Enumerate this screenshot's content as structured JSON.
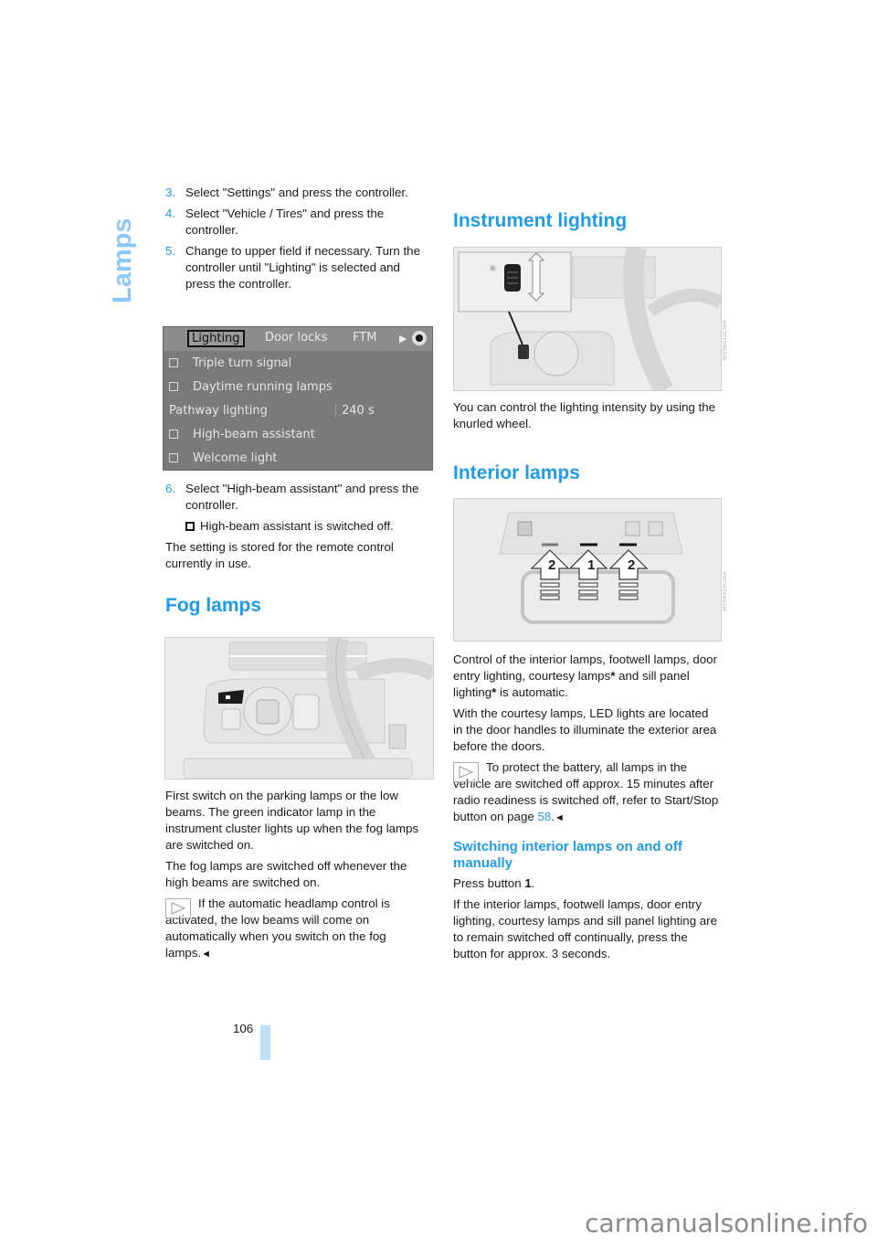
{
  "section_title": "Lamps",
  "page_number": "106",
  "left_column": {
    "steps_a": [
      {
        "num": "3.",
        "text": "Select \"Settings\" and press the controller."
      },
      {
        "num": "4.",
        "text": "Select \"Vehicle / Tires\" and press the controller."
      },
      {
        "num": "5.",
        "text": "Change to upper field if necessary. Turn the controller until \"Lighting\" is selected and press the controller."
      }
    ],
    "screen": {
      "tabs": [
        "Lighting",
        "Door locks",
        "FTM"
      ],
      "selected_tab": "Lighting",
      "rows": [
        {
          "label": "Triple turn signal",
          "checked": false
        },
        {
          "label": "Daytime running lamps",
          "checked": false
        },
        {
          "label": "Pathway lighting",
          "value": "240 s"
        },
        {
          "label": "High-beam assistant",
          "checked": false
        },
        {
          "label": "Welcome light",
          "checked": false
        }
      ]
    },
    "step_6": {
      "num": "6.",
      "text": "Select \"High-beam assistant\" and press the controller."
    },
    "checkbox_note": "High-beam assistant is switched off.",
    "stored_text": "The setting is stored for the remote control currently in use.",
    "fog_heading": "Fog lamps",
    "fog_p1": "First switch on the parking lamps or the low beams. The green indicator lamp in the instrument cluster lights up when the fog lamps are switched on.",
    "fog_p2": "The fog lamps are switched off whenever the high beams are switched on.",
    "fog_note": "If the automatic headlamp control is activated, the low beams will come on automatically when you switch on the fog lamps.",
    "end_mark": "◄"
  },
  "right_column": {
    "instrument_heading": "Instrument lighting",
    "instrument_text": "You can control the lighting intensity by using the knurled wheel.",
    "interior_heading": "Interior lamps",
    "interior_labels": [
      "2",
      "1",
      "2"
    ],
    "interior_p1_a": "Control of the interior lamps, footwell lamps, door entry lighting, courtesy lamps",
    "interior_p1_b": " and sill panel lighting",
    "interior_p1_c": " is automatic.",
    "asterisk": "*",
    "interior_p2": "With the courtesy lamps, LED lights are located in the door handles to illuminate the exterior area before the doors.",
    "battery_note_a": "To protect the battery, all lamps in the vehicle are switched off approx. 15 minutes after radio readiness is switched off, refer to Start/Stop button on page ",
    "battery_note_link": "58",
    "battery_note_b": ".",
    "end_mark": "◄",
    "manual_heading": "Switching interior lamps on and off manually",
    "press_a": "Press button ",
    "press_b": "1",
    "press_c": ".",
    "manual_p": "If the interior lamps, footwell lamps, door entry lighting, courtesy lamps and sill panel lighting are to remain switched off continually, press the button for approx. 3 seconds."
  },
  "watermark": "carmanualsonline.info"
}
